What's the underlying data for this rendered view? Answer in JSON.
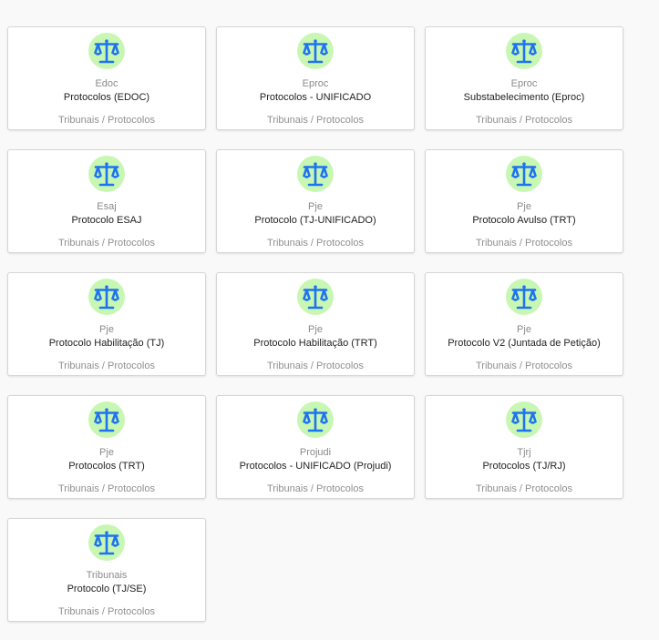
{
  "accent_color": "#1e73f0",
  "icon_bg_color": "#c8f7b4",
  "cards": [
    {
      "icon": "scales-of-justice-icon",
      "system": "Edoc",
      "name": "Protocolos (EDOC)",
      "category": "Tribunais / Protocolos"
    },
    {
      "icon": "scales-of-justice-icon",
      "system": "Eproc",
      "name": "Protocolos - UNIFICADO",
      "category": "Tribunais / Protocolos"
    },
    {
      "icon": "scales-of-justice-icon",
      "system": "Eproc",
      "name": "Substabelecimento (Eproc)",
      "category": "Tribunais / Protocolos"
    },
    {
      "icon": "scales-of-justice-icon",
      "system": "Esaj",
      "name": "Protocolo ESAJ",
      "category": "Tribunais / Protocolos"
    },
    {
      "icon": "scales-of-justice-icon",
      "system": "Pje",
      "name": "Protocolo (TJ-UNIFICADO)",
      "category": "Tribunais / Protocolos"
    },
    {
      "icon": "scales-of-justice-icon",
      "system": "Pje",
      "name": "Protocolo Avulso (TRT)",
      "category": "Tribunais / Protocolos"
    },
    {
      "icon": "scales-of-justice-icon",
      "system": "Pje",
      "name": "Protocolo Habilitação (TJ)",
      "category": "Tribunais / Protocolos"
    },
    {
      "icon": "scales-of-justice-icon",
      "system": "Pje",
      "name": "Protocolo Habilitação (TRT)",
      "category": "Tribunais / Protocolos"
    },
    {
      "icon": "scales-of-justice-icon",
      "system": "Pje",
      "name": "Protocolo V2 (Juntada de Petição)",
      "category": "Tribunais / Protocolos"
    },
    {
      "icon": "scales-of-justice-icon",
      "system": "Pje",
      "name": "Protocolos (TRT)",
      "category": "Tribunais / Protocolos"
    },
    {
      "icon": "scales-of-justice-icon",
      "system": "Projudi",
      "name": "Protocolos - UNIFICADO (Projudi)",
      "category": "Tribunais / Protocolos"
    },
    {
      "icon": "scales-of-justice-icon",
      "system": "Tjrj",
      "name": "Protocolos (TJ/RJ)",
      "category": "Tribunais / Protocolos"
    },
    {
      "icon": "scales-of-justice-icon",
      "system": "Tribunais",
      "name": "Protocolo (TJ/SE)",
      "category": "Tribunais / Protocolos"
    }
  ]
}
